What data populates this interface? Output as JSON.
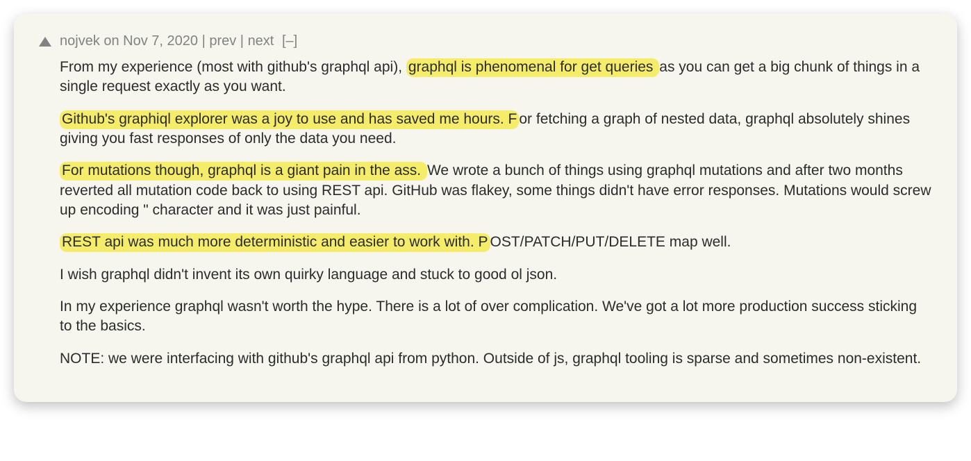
{
  "meta": {
    "author": "nojvek",
    "date": "Nov 7, 2020",
    "on": " on ",
    "prev": "prev",
    "next": "next",
    "collapse": "[–]",
    "sep": " | "
  },
  "comment": {
    "p1_a": "From my experience (most with github's graphql api), ",
    "p1_h": "graphql is phenomenal for get queries ",
    "p1_b": "as you can get a big chunk of things in a single request exactly as you want.",
    "p2_h": "Github's graphiql explorer was a joy to use and has saved me hours. F",
    "p2_a": "or fetching a graph of nested data, graphql absolutely shines giving you fast responses of only the data you need.",
    "p3_h": "For mutations though, graphql is a giant pain in the ass. ",
    "p3_a": "We wrote a bunch of things using graphql mutations and after two months reverted all mutation code back to using REST api. GitHub was flakey, some things didn't have error responses. Mutations would screw up encoding \" character and it was just painful.",
    "p4_h": "REST api was much more deterministic and easier to work with. P",
    "p4_a": "OST/PATCH/PUT/DELETE map well.",
    "p5": "I wish graphql didn't invent its own quirky language and stuck to good ol json.",
    "p6": "In my experience graphql wasn't worth the hype. There is a lot of over complication. We've got a lot more production success sticking to the basics.",
    "p7": "NOTE: we were interfacing with github's graphql api from python. Outside of js, graphql tooling is sparse and sometimes non-existent."
  }
}
